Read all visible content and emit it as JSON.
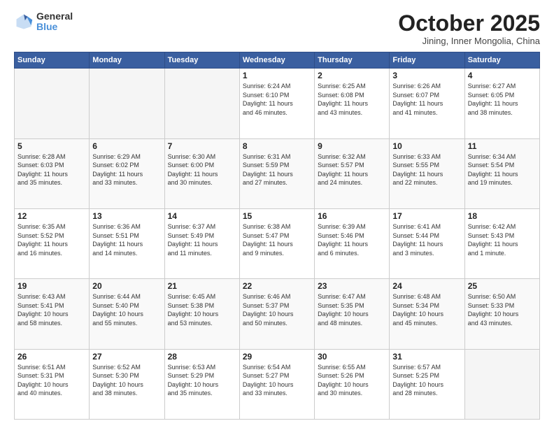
{
  "logo": {
    "general": "General",
    "blue": "Blue"
  },
  "header": {
    "month": "October 2025",
    "location": "Jining, Inner Mongolia, China"
  },
  "weekdays": [
    "Sunday",
    "Monday",
    "Tuesday",
    "Wednesday",
    "Thursday",
    "Friday",
    "Saturday"
  ],
  "weeks": [
    [
      {
        "day": "",
        "info": ""
      },
      {
        "day": "",
        "info": ""
      },
      {
        "day": "",
        "info": ""
      },
      {
        "day": "1",
        "info": "Sunrise: 6:24 AM\nSunset: 6:10 PM\nDaylight: 11 hours\nand 46 minutes."
      },
      {
        "day": "2",
        "info": "Sunrise: 6:25 AM\nSunset: 6:08 PM\nDaylight: 11 hours\nand 43 minutes."
      },
      {
        "day": "3",
        "info": "Sunrise: 6:26 AM\nSunset: 6:07 PM\nDaylight: 11 hours\nand 41 minutes."
      },
      {
        "day": "4",
        "info": "Sunrise: 6:27 AM\nSunset: 6:05 PM\nDaylight: 11 hours\nand 38 minutes."
      }
    ],
    [
      {
        "day": "5",
        "info": "Sunrise: 6:28 AM\nSunset: 6:03 PM\nDaylight: 11 hours\nand 35 minutes."
      },
      {
        "day": "6",
        "info": "Sunrise: 6:29 AM\nSunset: 6:02 PM\nDaylight: 11 hours\nand 33 minutes."
      },
      {
        "day": "7",
        "info": "Sunrise: 6:30 AM\nSunset: 6:00 PM\nDaylight: 11 hours\nand 30 minutes."
      },
      {
        "day": "8",
        "info": "Sunrise: 6:31 AM\nSunset: 5:59 PM\nDaylight: 11 hours\nand 27 minutes."
      },
      {
        "day": "9",
        "info": "Sunrise: 6:32 AM\nSunset: 5:57 PM\nDaylight: 11 hours\nand 24 minutes."
      },
      {
        "day": "10",
        "info": "Sunrise: 6:33 AM\nSunset: 5:55 PM\nDaylight: 11 hours\nand 22 minutes."
      },
      {
        "day": "11",
        "info": "Sunrise: 6:34 AM\nSunset: 5:54 PM\nDaylight: 11 hours\nand 19 minutes."
      }
    ],
    [
      {
        "day": "12",
        "info": "Sunrise: 6:35 AM\nSunset: 5:52 PM\nDaylight: 11 hours\nand 16 minutes."
      },
      {
        "day": "13",
        "info": "Sunrise: 6:36 AM\nSunset: 5:51 PM\nDaylight: 11 hours\nand 14 minutes."
      },
      {
        "day": "14",
        "info": "Sunrise: 6:37 AM\nSunset: 5:49 PM\nDaylight: 11 hours\nand 11 minutes."
      },
      {
        "day": "15",
        "info": "Sunrise: 6:38 AM\nSunset: 5:47 PM\nDaylight: 11 hours\nand 9 minutes."
      },
      {
        "day": "16",
        "info": "Sunrise: 6:39 AM\nSunset: 5:46 PM\nDaylight: 11 hours\nand 6 minutes."
      },
      {
        "day": "17",
        "info": "Sunrise: 6:41 AM\nSunset: 5:44 PM\nDaylight: 11 hours\nand 3 minutes."
      },
      {
        "day": "18",
        "info": "Sunrise: 6:42 AM\nSunset: 5:43 PM\nDaylight: 11 hours\nand 1 minute."
      }
    ],
    [
      {
        "day": "19",
        "info": "Sunrise: 6:43 AM\nSunset: 5:41 PM\nDaylight: 10 hours\nand 58 minutes."
      },
      {
        "day": "20",
        "info": "Sunrise: 6:44 AM\nSunset: 5:40 PM\nDaylight: 10 hours\nand 55 minutes."
      },
      {
        "day": "21",
        "info": "Sunrise: 6:45 AM\nSunset: 5:38 PM\nDaylight: 10 hours\nand 53 minutes."
      },
      {
        "day": "22",
        "info": "Sunrise: 6:46 AM\nSunset: 5:37 PM\nDaylight: 10 hours\nand 50 minutes."
      },
      {
        "day": "23",
        "info": "Sunrise: 6:47 AM\nSunset: 5:35 PM\nDaylight: 10 hours\nand 48 minutes."
      },
      {
        "day": "24",
        "info": "Sunrise: 6:48 AM\nSunset: 5:34 PM\nDaylight: 10 hours\nand 45 minutes."
      },
      {
        "day": "25",
        "info": "Sunrise: 6:50 AM\nSunset: 5:33 PM\nDaylight: 10 hours\nand 43 minutes."
      }
    ],
    [
      {
        "day": "26",
        "info": "Sunrise: 6:51 AM\nSunset: 5:31 PM\nDaylight: 10 hours\nand 40 minutes."
      },
      {
        "day": "27",
        "info": "Sunrise: 6:52 AM\nSunset: 5:30 PM\nDaylight: 10 hours\nand 38 minutes."
      },
      {
        "day": "28",
        "info": "Sunrise: 6:53 AM\nSunset: 5:29 PM\nDaylight: 10 hours\nand 35 minutes."
      },
      {
        "day": "29",
        "info": "Sunrise: 6:54 AM\nSunset: 5:27 PM\nDaylight: 10 hours\nand 33 minutes."
      },
      {
        "day": "30",
        "info": "Sunrise: 6:55 AM\nSunset: 5:26 PM\nDaylight: 10 hours\nand 30 minutes."
      },
      {
        "day": "31",
        "info": "Sunrise: 6:57 AM\nSunset: 5:25 PM\nDaylight: 10 hours\nand 28 minutes."
      },
      {
        "day": "",
        "info": ""
      }
    ]
  ]
}
